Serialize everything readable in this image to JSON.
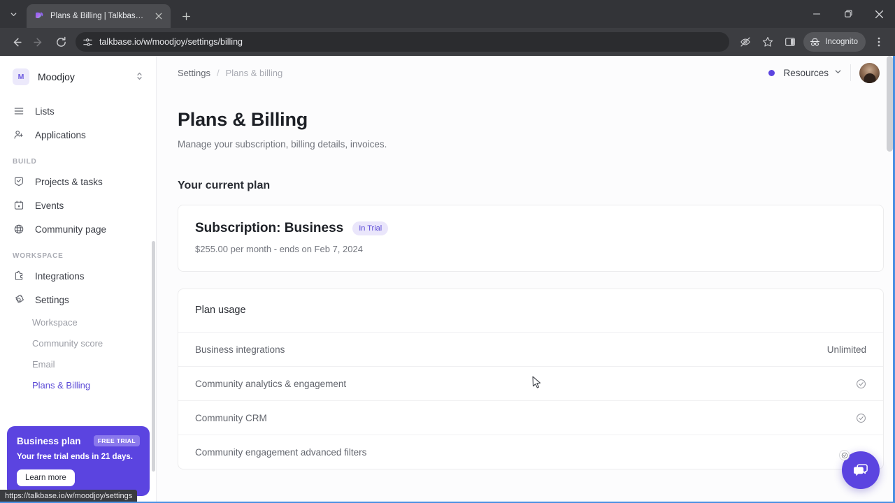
{
  "browser": {
    "tab": {
      "title": "Plans & Billing | Talkbase.io",
      "favicon_icon": "talkbase-logo-icon",
      "close_icon": "✕"
    },
    "tabstrip_chevron_icon": "⌄",
    "new_tab_icon": "+",
    "window": {
      "minimize_icon": "—",
      "maximize_icon": "❐",
      "close_icon": "✕"
    },
    "nav": {
      "back_icon": "←",
      "forward_icon": "→",
      "reload_icon": "⟳"
    },
    "omnibox": {
      "url": "talkbase.io/w/moodjoy/settings/billing",
      "site_settings_icon": "tune-icon"
    },
    "actions": {
      "tracking_protection_icon": "eye-slash-icon",
      "bookmark_icon": "star-icon",
      "side_panel_icon": "side-panel-icon",
      "incognito_label": "Incognito",
      "incognito_icon": "incognito-hat-icon",
      "menu_icon": "⋮"
    },
    "status_url": "https://talkbase.io/w/moodjoy/settings"
  },
  "sidebar": {
    "workspace": {
      "initial": "M",
      "name": "Moodjoy",
      "caret_icon": "updown-chevron-icon"
    },
    "primary_items": [
      {
        "label": "Lists",
        "icon": "list-icon"
      },
      {
        "label": "Applications",
        "icon": "user-plus-icon"
      }
    ],
    "sections": [
      {
        "title": "BUILD",
        "items": [
          {
            "label": "Projects & tasks",
            "icon": "task-check-icon"
          },
          {
            "label": "Events",
            "icon": "calendar-icon"
          },
          {
            "label": "Community page",
            "icon": "globe-icon"
          }
        ]
      },
      {
        "title": "WORKSPACE",
        "items": [
          {
            "label": "Integrations",
            "icon": "puzzle-icon"
          },
          {
            "label": "Settings",
            "icon": "gear-icon"
          }
        ]
      }
    ],
    "settings_subitems": [
      {
        "label": "Workspace",
        "active": false
      },
      {
        "label": "Community score",
        "active": false
      },
      {
        "label": "Email",
        "active": false
      },
      {
        "label": "Plans & Billing",
        "active": true
      }
    ],
    "trial_card": {
      "title": "Business plan",
      "badge": "FREE TRIAL",
      "message": "Your free trial ends in 21 days.",
      "button": "Learn more",
      "background_color": "#5b44e0"
    }
  },
  "topbar": {
    "breadcrumb": {
      "parent": "Settings",
      "separator": "/",
      "current": "Plans & billing"
    },
    "status_dot_color": "#5b44e0",
    "resources_label": "Resources",
    "resources_caret_icon": "chevron-down-icon",
    "avatar_name": "user-avatar"
  },
  "main": {
    "page_title": "Plans & Billing",
    "page_subtitle": "Manage your subscription, billing details, invoices.",
    "current_plan_heading": "Your current plan",
    "subscription": {
      "title": "Subscription: Business",
      "badge": "In Trial",
      "badge_color": "#5b4ad6",
      "meta": "$255.00 per month - ends on Feb 7, 2024"
    },
    "plan_usage": {
      "heading": "Plan usage",
      "rows": [
        {
          "label": "Business integrations",
          "value": "Unlimited",
          "type": "text"
        },
        {
          "label": "Community analytics & engagement",
          "value": "✓",
          "type": "check"
        },
        {
          "label": "Community CRM",
          "value": "✓",
          "type": "check"
        },
        {
          "label": "Community engagement advanced filters",
          "value": "",
          "type": "none"
        }
      ]
    },
    "chat_widget": {
      "name": "chat-launcher",
      "color": "#5b44e0"
    }
  }
}
